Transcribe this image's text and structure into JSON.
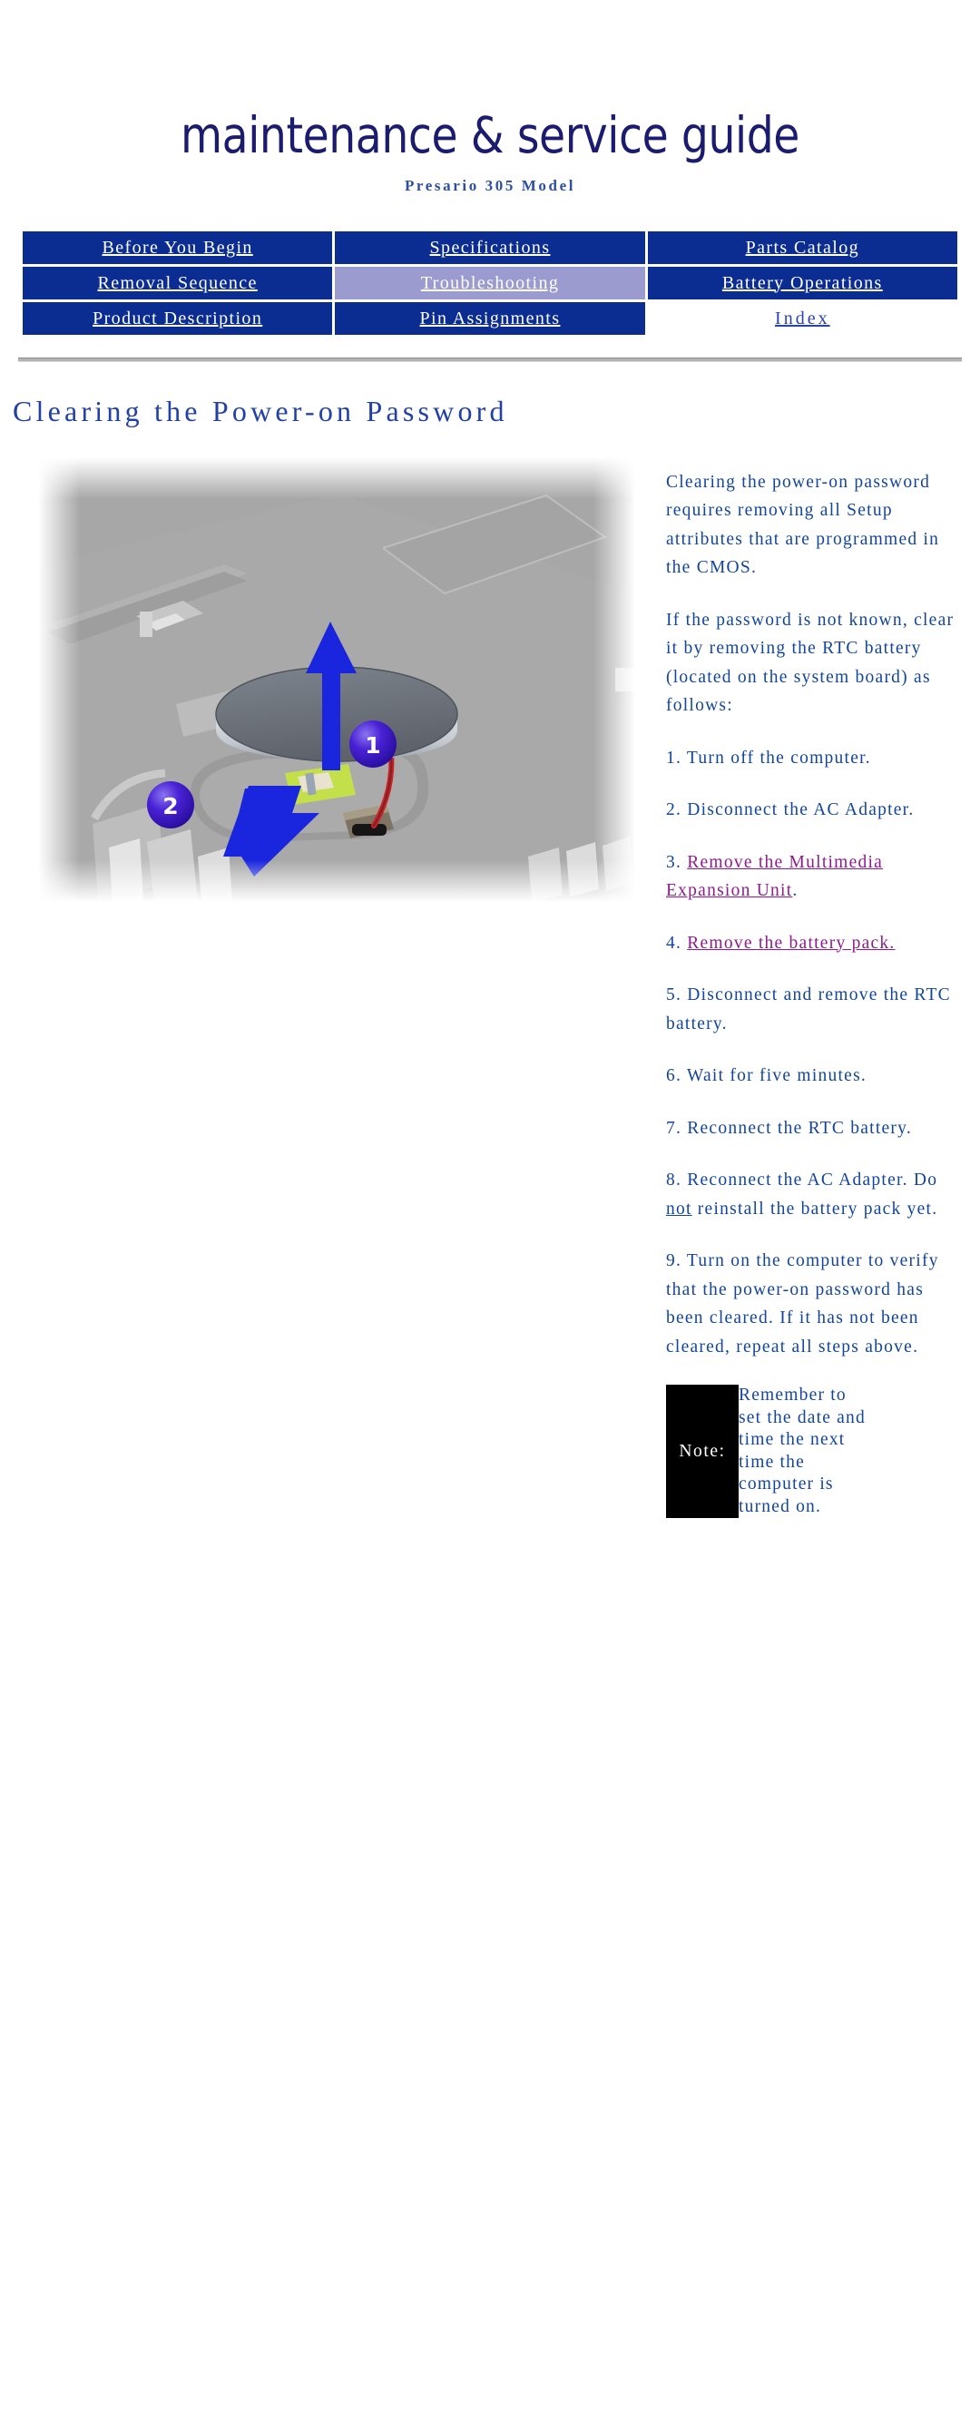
{
  "header": {
    "title": "maintenance & service guide",
    "subtitle": "Presario 305 Model"
  },
  "nav": {
    "rows": [
      [
        {
          "label": "Before You Begin",
          "state": "link"
        },
        {
          "label": "Specifications",
          "state": "link"
        },
        {
          "label": "Parts Catalog",
          "state": "link"
        }
      ],
      [
        {
          "label": "Removal Sequence",
          "state": "link"
        },
        {
          "label": "Troubleshooting",
          "state": "active"
        },
        {
          "label": "Battery Operations",
          "state": "link"
        }
      ],
      [
        {
          "label": "Product Description",
          "state": "link"
        },
        {
          "label": "Pin Assignments",
          "state": "link"
        },
        {
          "label": "Index",
          "state": "plain"
        }
      ]
    ]
  },
  "page": {
    "heading": "Clearing the Power-on Password"
  },
  "figure": {
    "alt": "RTC battery removal from system board",
    "callouts": [
      "1",
      "2"
    ],
    "colors": {
      "board": "#a8a8a8",
      "arrow": "#1a26dd",
      "callout": "#3a16c8",
      "battery_top": "#6b7079",
      "battery_side": "#c9ced6",
      "wire_red": "#d61f26",
      "connector": "#6e6450",
      "pad_green": "#bede42"
    }
  },
  "body": {
    "paragraphs": [
      "Clearing the power-on password requires removing all Setup attributes that are programmed in the CMOS.",
      "If the password is not known, clear it by removing the RTC battery (located on the system board) as follows:"
    ],
    "steps": [
      {
        "num": "1.",
        "text": "Turn off the computer."
      },
      {
        "num": "2.",
        "text": "Disconnect the AC Adapter."
      },
      {
        "num": "3.",
        "link": "Remove the Multimedia Expansion Unit",
        "tail": "."
      },
      {
        "num": "4.",
        "link": "Remove the battery pack.",
        "tail": ""
      },
      {
        "num": "5.",
        "text": "Disconnect and remove the RTC battery."
      },
      {
        "num": "6.",
        "text": "Wait for five minutes."
      },
      {
        "num": "7.",
        "text": "Reconnect the RTC battery."
      },
      {
        "num": "8.",
        "pre": "Reconnect the AC Adapter. Do ",
        "emph": "not",
        "post": " reinstall the battery pack yet."
      },
      {
        "num": "9.",
        "text": "Turn on the computer to verify that the power-on password has been cleared. If it has not been cleared, repeat all steps above."
      }
    ],
    "note": {
      "label": "Note:",
      "text": "Remember to set the date and time the next time the computer is turned on."
    }
  }
}
